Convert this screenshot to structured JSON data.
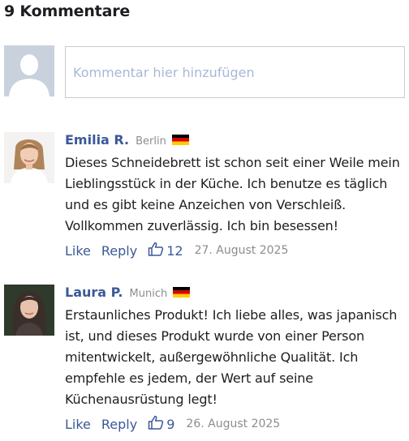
{
  "header": {
    "title": "9 Kommentare"
  },
  "composer": {
    "placeholder": "Kommentar hier hinzufügen"
  },
  "comments": [
    {
      "author": "Emilia R.",
      "location": "Berlin",
      "flag": "germany-flag",
      "text": "Dieses Schneidebrett ist schon seit einer Weile mein Lieblingsstück in der Küche. Ich benutze es täglich und es gibt keine Anzeichen von Verschleiß. Vollkommen zuverlässig. Ich bin besessen!",
      "like_label": "Like",
      "reply_label": "Reply",
      "likes": "12",
      "date": "27. August 2025"
    },
    {
      "author": "Laura P.",
      "location": "Munich",
      "flag": "germany-flag",
      "text": "Erstaunliches Produkt! Ich liebe alles, was japanisch ist, und dieses Produkt wurde von einer Person mitentwickelt, außergewöhnliche Qualität. Ich empfehle es jedem, der Wert auf seine Küchenausrüstung legt!",
      "like_label": "Like",
      "reply_label": "Reply",
      "likes": "9",
      "date": "26. August 2025"
    }
  ],
  "colors": {
    "accent": "#3b5998",
    "muted": "#8a8d91",
    "placeholder": "#a9b8d6"
  },
  "icons": {
    "like": "thumbs-up-icon",
    "default_avatar": "default-avatar-icon"
  }
}
